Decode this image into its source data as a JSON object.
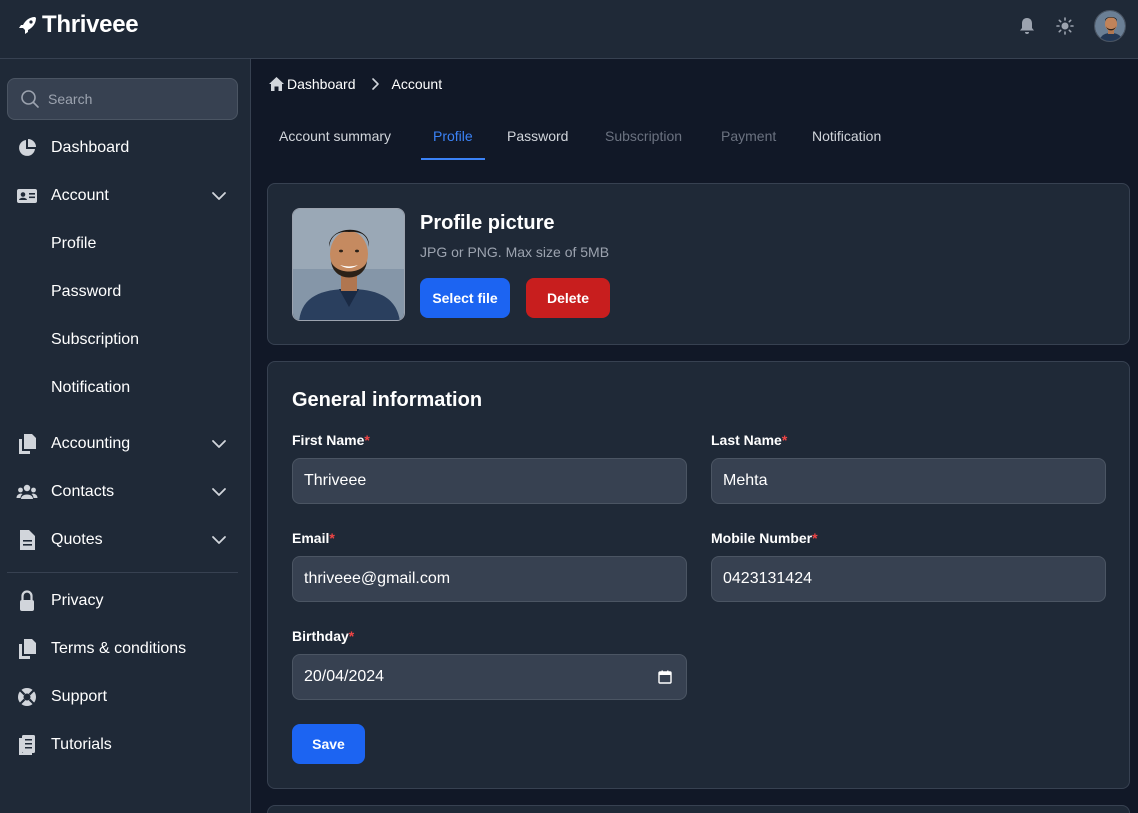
{
  "app": {
    "name": "Thriveee"
  },
  "sidebar": {
    "search_placeholder": "Search",
    "items": [
      {
        "label": "Dashboard",
        "icon": "pie-chart-icon"
      },
      {
        "label": "Account",
        "icon": "id-card-icon"
      },
      {
        "label": "Profile"
      },
      {
        "label": "Password"
      },
      {
        "label": "Subscription"
      },
      {
        "label": "Notification"
      },
      {
        "label": "Accounting",
        "icon": "documents-icon"
      },
      {
        "label": "Contacts",
        "icon": "users-icon"
      },
      {
        "label": "Quotes",
        "icon": "file-icon"
      },
      {
        "label": "Privacy",
        "icon": "lock-icon"
      },
      {
        "label": "Terms & conditions",
        "icon": "copy-icon"
      },
      {
        "label": "Support",
        "icon": "lifebuoy-icon"
      },
      {
        "label": "Tutorials",
        "icon": "book-icon"
      }
    ]
  },
  "breadcrumb": {
    "home": "Dashboard",
    "current": "Account"
  },
  "tabs": [
    {
      "label": "Account summary"
    },
    {
      "label": "Profile"
    },
    {
      "label": "Password"
    },
    {
      "label": "Subscription"
    },
    {
      "label": "Payment"
    },
    {
      "label": "Notification"
    }
  ],
  "profile_picture": {
    "title": "Profile picture",
    "subtitle": "JPG or PNG. Max size of 5MB",
    "select_label": "Select file",
    "delete_label": "Delete"
  },
  "general": {
    "title": "General information",
    "required_mark": "*",
    "first_name_label": "First Name",
    "first_name": "Thriveee",
    "last_name_label": "Last Name",
    "last_name": "Mehta",
    "email_label": "Email",
    "email": "thriveee@gmail.com",
    "mobile_label": "Mobile Number",
    "mobile": "0423131424",
    "birthday_label": "Birthday",
    "birthday": "20/04/2024",
    "save_label": "Save"
  },
  "colors": {
    "accent": "#1c64f2",
    "danger": "#c81e1e",
    "required": "#ef4444"
  }
}
